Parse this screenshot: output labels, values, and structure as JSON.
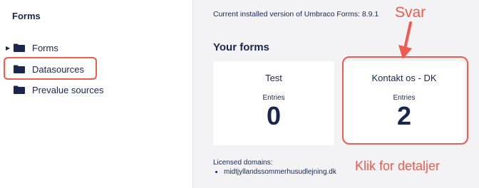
{
  "sidebar": {
    "title": "Forms",
    "items": [
      {
        "label": "Forms",
        "icon": "folder-icon",
        "expandable": true
      },
      {
        "label": "Datasources",
        "icon": "folder-icon",
        "expandable": false
      },
      {
        "label": "Prevalue sources",
        "icon": "folder-icon",
        "expandable": false
      }
    ]
  },
  "main": {
    "version_text": "Current installed version of Umbraco Forms: 8.9.1",
    "section_title": "Your forms",
    "forms": [
      {
        "name": "Test",
        "entries_label": "Entries",
        "count": "0"
      },
      {
        "name": "Kontakt os - DK",
        "entries_label": "Entries",
        "count": "2"
      }
    ],
    "licensed_label": "Licensed domains:",
    "licensed_domains": [
      "midtjyllandssommerhusudlejning.dk"
    ]
  },
  "annotations": {
    "svar": "Svar",
    "klik": "Klik for detaljer",
    "color": "#ef5b4c"
  },
  "colors": {
    "text": "#1b264f",
    "background_main": "#f3f3f5",
    "accent": "#ef5b4c"
  }
}
